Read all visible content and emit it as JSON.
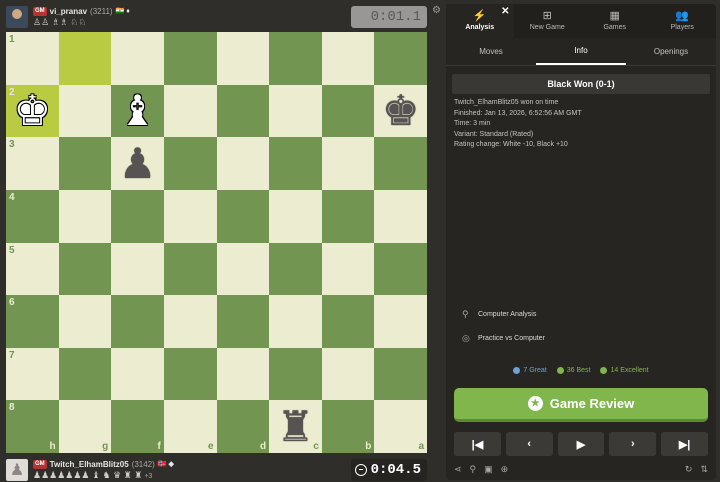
{
  "top_player": {
    "title": "GM",
    "name": "vi_pranav",
    "rating": "(3211)",
    "flags": "🇮🇳 ♦",
    "captured": "♙♙ ♗♗ ♘♘",
    "clock": "0:01.1"
  },
  "bottom_player": {
    "title": "GM",
    "name": "Twitch_ElhamBlitz05",
    "rating": "(3142)",
    "flags": "🇳🇴 ◆",
    "captured": "♟♟♟♟♟♟♟ ♝ ♞ ♛ ♜ ♜",
    "advantage": "+3",
    "clock": "0:04.5"
  },
  "board": {
    "orientation": "black",
    "ranks": [
      "1",
      "2",
      "3",
      "4",
      "5",
      "6",
      "7",
      "8"
    ],
    "files": [
      "h",
      "g",
      "f",
      "e",
      "d",
      "c",
      "b",
      "a"
    ],
    "highlighted_squares": [
      "g1",
      "h2"
    ],
    "pieces": [
      {
        "square": "h2",
        "piece": "white-king",
        "glyph": "♚"
      },
      {
        "square": "f2",
        "piece": "white-bishop",
        "glyph": "♝"
      },
      {
        "square": "a2",
        "piece": "black-king",
        "glyph": "♚"
      },
      {
        "square": "f3",
        "piece": "black-pawn",
        "glyph": "♟"
      },
      {
        "square": "c8",
        "piece": "black-rook",
        "glyph": "♜"
      }
    ]
  },
  "panel": {
    "close": "✕",
    "nav_tabs": [
      {
        "label": "Analysis",
        "icon": "⚡",
        "icon_name": "lightning-icon",
        "active": true
      },
      {
        "label": "New Game",
        "icon": "⊞",
        "icon_name": "plus-square-icon",
        "active": false
      },
      {
        "label": "Games",
        "icon": "▦",
        "icon_name": "board-icon",
        "active": false
      },
      {
        "label": "Players",
        "icon": "👥",
        "icon_name": "players-icon",
        "active": false
      }
    ],
    "sub_tabs": [
      {
        "label": "Moves",
        "active": false
      },
      {
        "label": "Info",
        "active": true
      },
      {
        "label": "Openings",
        "active": false
      }
    ],
    "result": "Black Won (0-1)",
    "info_lines": [
      "Twitch_ElhamBlitz05 won on time",
      "Finished: Jan 13, 2026, 6:52:56 AM GMT",
      "Time: 3 min",
      "Variant: Standard (Rated)",
      "Rating change: White -10, Black +10"
    ],
    "links": [
      {
        "label": "Computer Analysis",
        "icon": "⚲",
        "icon_name": "analysis-icon"
      },
      {
        "label": "Practice vs Computer",
        "icon": "◎",
        "icon_name": "computer-icon"
      }
    ],
    "stats": {
      "great": "7 Great",
      "best": "36 Best",
      "excellent": "14 Excellent"
    },
    "review_button": "Game Review",
    "nav_buttons": {
      "first": "|◀",
      "prev": "‹",
      "play": "▶",
      "next": "›",
      "last": "▶|"
    }
  },
  "colors": {
    "light_square": "#ebecd0",
    "dark_square": "#739552",
    "highlight_light": "#c2cb3c",
    "highlight_dark": "#b9ca43",
    "review_green": "#81b64c",
    "great_blue": "#6e9fd5"
  }
}
